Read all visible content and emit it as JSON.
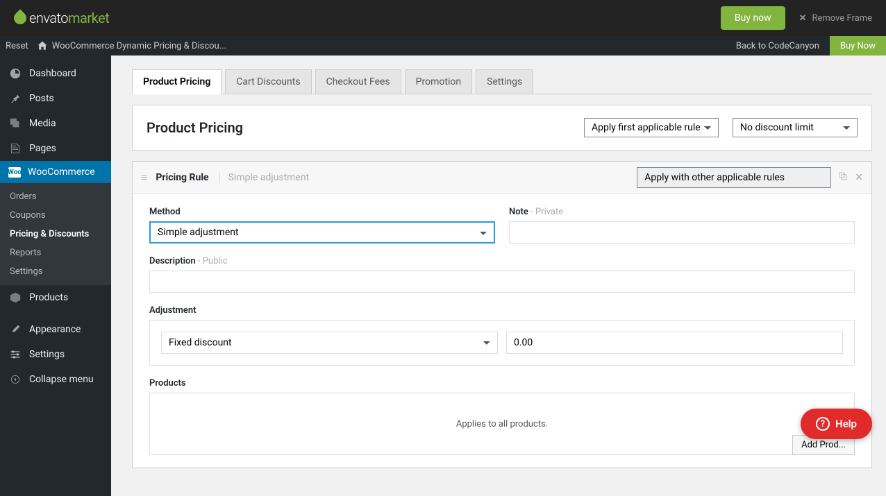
{
  "envato": {
    "logo_envato": "envato",
    "logo_market": "market",
    "buy_now": "Buy now",
    "remove_frame": "Remove Frame"
  },
  "wpbar": {
    "reset": "Reset",
    "site_title": "WooCommerce Dynamic Pricing & Discou...",
    "back": "Back to CodeCanyon",
    "buy_now": "Buy Now"
  },
  "sidebar": {
    "dashboard": "Dashboard",
    "posts": "Posts",
    "media": "Media",
    "pages": "Pages",
    "woocommerce": "WooCommerce",
    "sub": {
      "orders": "Orders",
      "coupons": "Coupons",
      "pricing": "Pricing & Discounts",
      "reports": "Reports",
      "settings": "Settings"
    },
    "products": "Products",
    "appearance": "Appearance",
    "settings": "Settings",
    "collapse": "Collapse menu"
  },
  "tabs": {
    "product_pricing": "Product Pricing",
    "cart_discounts": "Cart Discounts",
    "checkout_fees": "Checkout Fees",
    "promotion": "Promotion",
    "settings": "Settings"
  },
  "panel": {
    "title": "Product Pricing",
    "apply_rule": "Apply first applicable rule",
    "discount_limit": "No discount limit"
  },
  "rule": {
    "title": "Pricing Rule",
    "subtitle": "Simple adjustment",
    "apply_with": "Apply with other applicable rules",
    "method_label": "Method",
    "method_value": "Simple adjustment",
    "note_label": "Note",
    "note_hint": " - Private",
    "description_label": "Description",
    "description_hint": " - Public",
    "adjustment_label": "Adjustment",
    "adjustment_type": "Fixed discount",
    "adjustment_value": "0.00",
    "products_label": "Products",
    "products_empty": "Applies to all products.",
    "add_product": "Add Prod..."
  },
  "help": {
    "label": "Help"
  }
}
